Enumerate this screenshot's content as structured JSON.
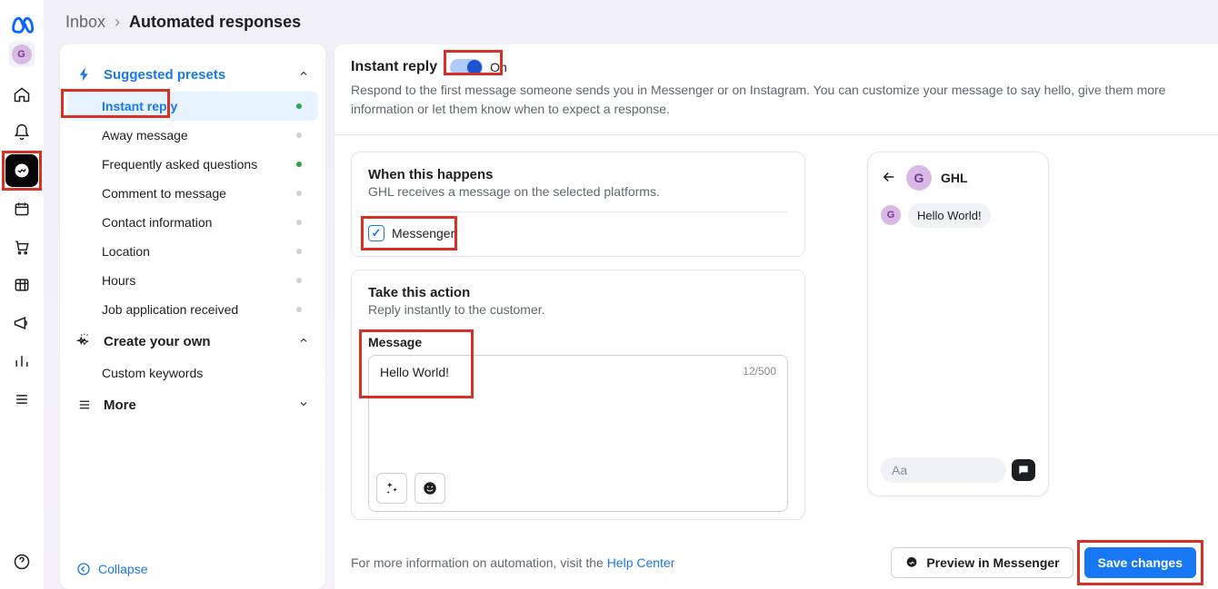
{
  "rail": {
    "avatar_initial": "G"
  },
  "breadcrumb": {
    "parent": "Inbox",
    "current": "Automated responses"
  },
  "sidebar": {
    "presets_label": "Suggested presets",
    "items": [
      {
        "label": "Instant reply",
        "active": true,
        "status": "on"
      },
      {
        "label": "Away message",
        "status": "off"
      },
      {
        "label": "Frequently asked questions",
        "status": "on"
      },
      {
        "label": "Comment to message",
        "status": "off"
      },
      {
        "label": "Contact information",
        "status": "off"
      },
      {
        "label": "Location",
        "status": "off"
      },
      {
        "label": "Hours",
        "status": "off"
      },
      {
        "label": "Job application received",
        "status": "off"
      }
    ],
    "create_label": "Create your own",
    "create_items": [
      "Custom keywords"
    ],
    "more_label": "More",
    "collapse_label": "Collapse"
  },
  "content": {
    "title": "Instant reply",
    "toggle_state": "On",
    "description": "Respond to the first message someone sends you in Messenger or on Instagram. You can customize your message to say hello, give them more information or let them know when to expect a response.",
    "when": {
      "heading": "When this happens",
      "sub": "GHL receives a message on the selected platforms.",
      "messenger_label": "Messenger",
      "messenger_checked": true
    },
    "action": {
      "heading": "Take this action",
      "sub": "Reply instantly to the customer.",
      "message_label": "Message",
      "message_text": "Hello World!",
      "counter": "12/500"
    },
    "footer": {
      "info_prefix": "For more information on automation, visit the ",
      "help_link": "Help Center",
      "preview_btn": "Preview in Messenger",
      "save_btn": "Save changes"
    }
  },
  "preview": {
    "name": "GHL",
    "initial": "G",
    "message": "Hello World!",
    "input_placeholder": "Aa"
  }
}
